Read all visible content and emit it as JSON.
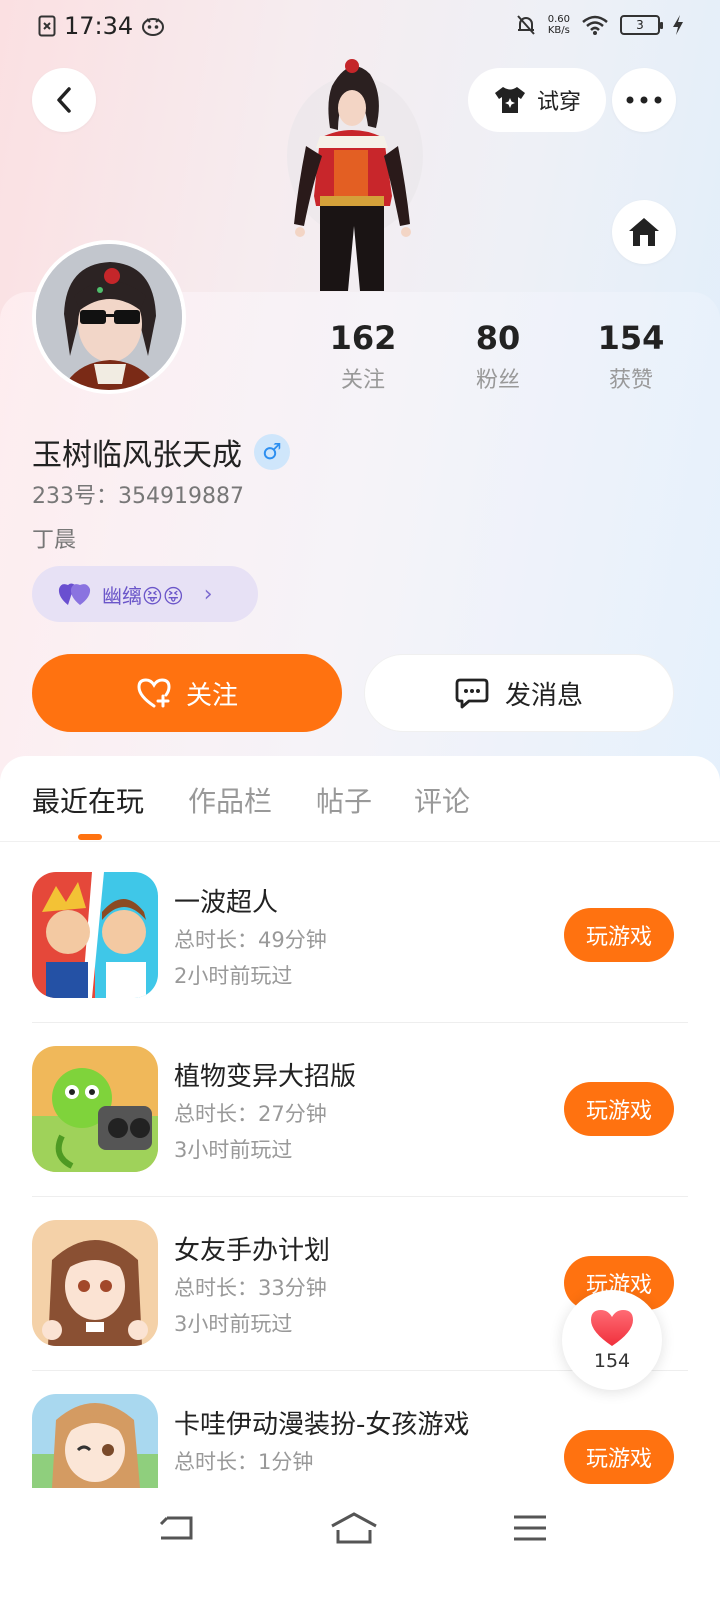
{
  "status_bar": {
    "time": "17:34",
    "net_speed": "0.60",
    "net_unit": "KB/s",
    "battery": "3"
  },
  "header": {
    "try_on_label": "试穿"
  },
  "profile": {
    "stats": [
      {
        "value": "162",
        "label": "关注"
      },
      {
        "value": "80",
        "label": "粉丝"
      },
      {
        "value": "154",
        "label": "获赞"
      }
    ],
    "username": "玉树临风张天成",
    "gender_symbol": "♂",
    "uid": "233号：354919887",
    "bio": "丁晨",
    "tag": "幽缡😝😝",
    "follow_label": "关注",
    "message_label": "发消息"
  },
  "tabs": [
    {
      "label": "最近在玩",
      "active": true
    },
    {
      "label": "作品栏",
      "active": false
    },
    {
      "label": "帖子",
      "active": false
    },
    {
      "label": "评论",
      "active": false
    }
  ],
  "games": [
    {
      "name": "一波超人",
      "duration": "总时长：49分钟",
      "last_played": "2小时前玩过",
      "button": "玩游戏"
    },
    {
      "name": "植物变异大招版",
      "duration": "总时长：27分钟",
      "last_played": "3小时前玩过",
      "button": "玩游戏"
    },
    {
      "name": "女友手办计划",
      "duration": "总时长：33分钟",
      "last_played": "3小时前玩过",
      "button": "玩游戏"
    },
    {
      "name": "卡哇伊动漫装扮-女孩游戏",
      "duration": "总时长：1分钟",
      "last_played": "",
      "button": "玩游戏"
    }
  ],
  "like_fab": {
    "count": "154"
  },
  "colors": {
    "accent": "#ff7210",
    "tag_text": "#6b56c9",
    "gender": "#2d8ff0"
  }
}
